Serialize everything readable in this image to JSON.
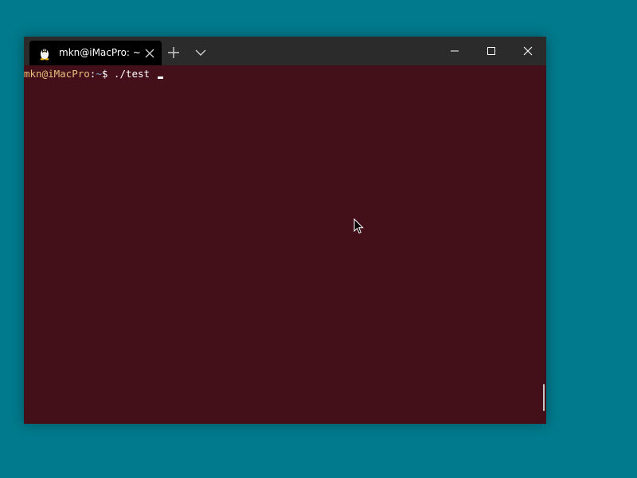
{
  "window": {
    "tab": {
      "icon": "tux-linux-icon",
      "title": "mkn@iMacPro: ~",
      "close_icon": "close-icon"
    },
    "new_tab_icon": "plus-icon",
    "dropdown_icon": "chevron-down-icon",
    "controls": {
      "minimize_icon": "minimize-icon",
      "maximize_icon": "maximize-icon",
      "close_icon": "close-icon"
    }
  },
  "terminal": {
    "prompt_user_host": "mkn@iMacPro",
    "prompt_colon": ":",
    "prompt_path": "~",
    "prompt_symbol": "$ ",
    "command": "./test"
  },
  "colors": {
    "desktop": "#007a8c",
    "terminal_background": "#43101a",
    "titlebar": "#2b2b2b",
    "active_tab": "#000000",
    "prompt_user": "#e5c07b",
    "prompt_path": "#7aa6da"
  }
}
